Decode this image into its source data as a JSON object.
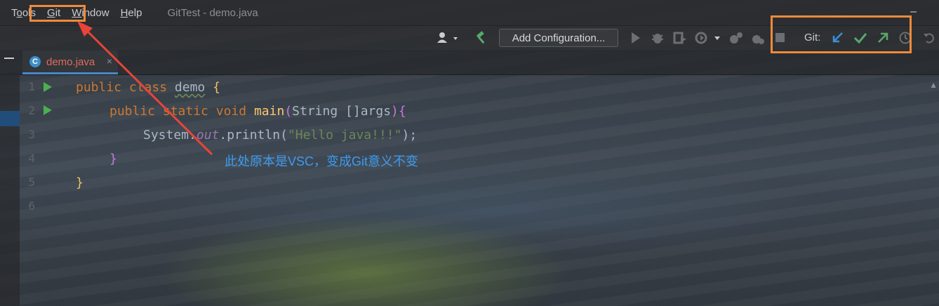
{
  "menubar": {
    "items": [
      {
        "label": "Tools",
        "mnemonic_index": 1
      },
      {
        "label": "Git",
        "mnemonic_index": 0
      },
      {
        "label": "Window",
        "mnemonic_index": 0
      },
      {
        "label": "Help",
        "mnemonic_index": 0
      }
    ],
    "window_title": "GitTest - demo.java",
    "minimize_label": "–"
  },
  "toolbar": {
    "add_configuration_label": "Add Configuration...",
    "git_label": "Git:",
    "icons": {
      "account": "user-icon",
      "build": "hammer-icon",
      "run": "play-icon",
      "debug": "bug-icon",
      "coverage": "coverage-icon",
      "profile": "profiler-icon",
      "attach": "attach-icon",
      "stop": "stop-icon",
      "update": "git-update-icon",
      "commit": "git-commit-icon",
      "push": "git-push-icon",
      "history": "history-icon",
      "rollback": "rollback-icon"
    }
  },
  "tab": {
    "file_name": "demo.java",
    "icon_letter": "C",
    "close_glyph": "×"
  },
  "editor": {
    "line_numbers": [
      "1",
      "2",
      "3",
      "4",
      "5",
      "6"
    ],
    "code": {
      "l1_public": "public",
      "l1_class": "class",
      "l1_name": "demo",
      "l1_brace": "{",
      "l2_public": "public",
      "l2_static": "static",
      "l2_void": "void",
      "l2_main": "main",
      "l2_params_open": "(",
      "l2_params": "String []args",
      "l2_params_close": ")",
      "l2_brace": "{",
      "l3_system": "System.",
      "l3_out": "out",
      "l3_println": ".println(",
      "l3_string": "\"Hello java!!!\"",
      "l3_end": ");",
      "l4_close": "}",
      "l5_close": "}"
    }
  },
  "annotation": {
    "text": "此处原本是VSC，变成Git意义不变"
  },
  "colors": {
    "highlight_box": "#f08a3a",
    "arrow": "#e8443a",
    "annotation_text": "#3d9bf0",
    "keyword": "#cc7832",
    "string": "#6a8759"
  }
}
